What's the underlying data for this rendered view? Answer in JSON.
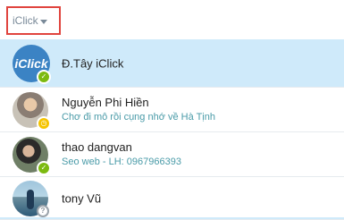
{
  "header": {
    "group_label": "iClick"
  },
  "contacts": [
    {
      "name": "Đ.Tây iClick",
      "mood": "",
      "status": "online",
      "selected": true,
      "avatar_text": "iClick"
    },
    {
      "name": "Nguyễn Phi Hiền",
      "mood": "Chơ đi mô rồi cụng nhớ về Hà Tịnh",
      "status": "away"
    },
    {
      "name": "thao dangvan",
      "mood": "Seo web - LH: 0967966393",
      "status": "online"
    },
    {
      "name": "tony Vũ",
      "mood": "",
      "status": "unknown"
    }
  ],
  "colors": {
    "selected_bg": "#cfeafa",
    "online": "#7cba10",
    "away": "#f5c400",
    "mood_text": "#4a9ba8",
    "highlight_border": "#e0443e"
  },
  "icons": {
    "caret": "chevron-down-icon",
    "online_status": "check-icon",
    "away_status": "clock-icon",
    "unknown_status": "question-icon"
  }
}
